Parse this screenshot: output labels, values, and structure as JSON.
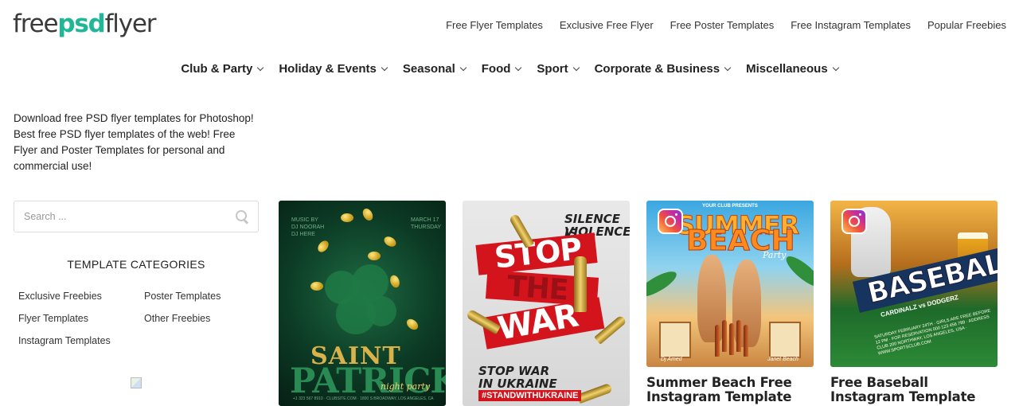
{
  "logo": {
    "part1": "free",
    "part2": "psd",
    "part3": "flyer"
  },
  "top_nav": [
    "Free Flyer Templates",
    "Exclusive Free Flyer",
    "Free Poster Templates",
    "Free Instagram Templates",
    "Popular Freebies"
  ],
  "main_nav": [
    "Club & Party",
    "Holiday & Events",
    "Seasonal",
    "Food",
    "Sport",
    "Corporate & Business",
    "Miscellaneous"
  ],
  "intro": "Download free PSD flyer templates for Photoshop! Best free PSD flyer templates of the web! Free Flyer and Poster Templates for personal and commercial use!",
  "search": {
    "placeholder": "Search ..."
  },
  "sidebar": {
    "categories_title": "TEMPLATE CATEGORIES",
    "categories": [
      "Exclusive Freebies",
      "Poster Templates",
      "Flyer Templates",
      "Other Freebies",
      "Instagram Templates"
    ]
  },
  "cards": [
    {
      "title": "",
      "thumb": {
        "top_left": "MUSIC BY\nDJ NOORAH\nDJ HERE",
        "top_right": "MARCH 17\nTHURSDAY",
        "line1": "SAINT",
        "line2": "PATRICK",
        "script": "night party",
        "footer": "+1 323 567 8910 · CLUBSITE.COM · 1800 S BROADWAY, LOS ANGELES, CA"
      }
    },
    {
      "title": "",
      "thumb": {
        "line1": "SILENCE IS",
        "line2": "VIOLENCE",
        "stop": "STOP",
        "the": "THE",
        "war": "WAR",
        "bottom1": "STOP WAR",
        "bottom2": "IN UKRAINE",
        "tag": "#STANDWITHUKRAINE"
      }
    },
    {
      "title": "Summer Beach Free Instagram Template",
      "thumb": {
        "top": "YOUR CLUB PRESENTS",
        "line1": "SUMMER",
        "line2": "BEACH",
        "script": "Party",
        "dj1": "Dj Amed",
        "dj2": "Janet Beach"
      }
    },
    {
      "title": "Free Baseball Instagram Template",
      "thumb": {
        "line1": "BASEBALL",
        "teams": "CARDINALZ vs DODGERZ",
        "info": "SATURDAY FEBRUARY 24TH · GIRLS ARE FREE BEFORE 12 PM · FOR RESERVATION 000 123 456 789 · ADDRESS CLUB 200 NORTHWAY, LOS ANGELES, USA · WWW.SPORTSCLUB.COM"
      }
    }
  ],
  "colors": {
    "brand_green": "#1fb795",
    "text": "#222222",
    "stop_red": "#d4141c"
  }
}
